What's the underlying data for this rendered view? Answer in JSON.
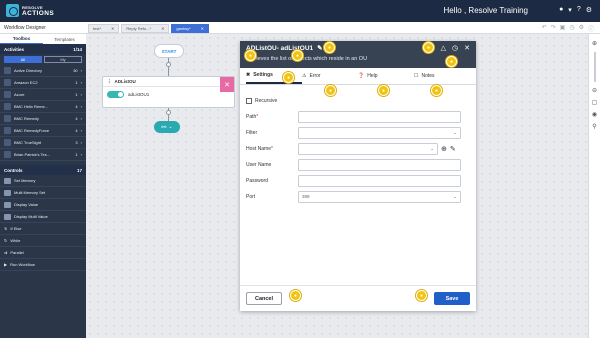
{
  "header": {
    "logo_small": "RESOLVE",
    "logo_big": "ACTIONS",
    "greeting": "Hello , Resolve Training",
    "icons": [
      "user-icon",
      "chevron-down-icon",
      "help-icon",
      "settings-icon"
    ]
  },
  "designer": {
    "title": "Workflow Designer",
    "tabs": [
      {
        "label": "test*",
        "active": false
      },
      {
        "label": "Reply Refu...*",
        "active": false
      },
      {
        "label": "ganksy*",
        "active": true
      }
    ]
  },
  "left_panel": {
    "tabs": [
      "Toolbox",
      "Templates"
    ],
    "activities": {
      "title": "Activities",
      "count": "1/14",
      "filter": [
        "All",
        "My"
      ],
      "items": [
        {
          "label": "Active Directory",
          "count": "30"
        },
        {
          "label": "Amazon EC2",
          "count": "1"
        },
        {
          "label": "Azure",
          "count": "1"
        },
        {
          "label": "BMC Helix Reme...",
          "count": "4"
        },
        {
          "label": "BMC Remedy",
          "count": "4"
        },
        {
          "label": "BMC RemedyForce",
          "count": "4"
        },
        {
          "label": "BMC TrueSight",
          "count": "3"
        },
        {
          "label": "Brian Patrick's Tes...",
          "count": "1"
        }
      ]
    },
    "controls": {
      "title": "Controls",
      "count": "17",
      "items": [
        "Set Memory",
        "Multi Memory Set",
        "Display Value",
        "Display Multi Value",
        "If Else",
        "While",
        "Parallel",
        "Run Workflow"
      ]
    }
  },
  "canvas": {
    "start_label": "START",
    "card_title": "ADListOU",
    "card_item": "adListOU1"
  },
  "modal": {
    "title": "ADListOU- adListOU1",
    "subtitle": "Retrieves the list of objects which reside in an OU",
    "tabs": [
      "Settings",
      "Error",
      "Help",
      "Notes"
    ],
    "recursive_label": "Recursive",
    "fields": [
      {
        "label": "Path",
        "required": "*",
        "value": ""
      },
      {
        "label": "Filter",
        "required": "",
        "value": ""
      },
      {
        "label": "Host Name",
        "required": "*",
        "value": ""
      },
      {
        "label": "User Name",
        "required": "",
        "value": ""
      },
      {
        "label": "Password",
        "required": "",
        "value": ""
      },
      {
        "label": "Port",
        "required": "",
        "value": "389"
      }
    ],
    "cancel_label": "Cancel",
    "save_label": "Save"
  },
  "colors": {
    "topbar": "#1d2a44",
    "left_panel": "#2b3648",
    "accent": "#3d6fd6",
    "save": "#1f5fc7",
    "hint": "#f1c40f",
    "remove": "#e86aa5",
    "switch": "#35b7b4"
  }
}
